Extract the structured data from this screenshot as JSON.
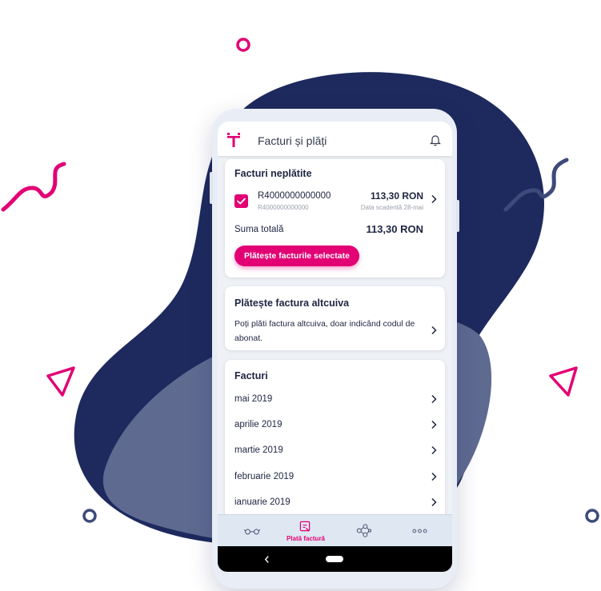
{
  "colors": {
    "brand": "#e20074",
    "navy": "#1e2a5e",
    "text": "#1e2541",
    "muted": "#9aa0ad"
  },
  "header": {
    "title": "Facturi și plăți",
    "logo_icon": "telekom-t-logo",
    "bell_icon": "bell-icon"
  },
  "unpaid": {
    "title": "Facturi neplătite",
    "invoice": {
      "checked": true,
      "id": "R4000000000000",
      "sub_id": "R4000000000000",
      "amount": "113,30 RON",
      "due": "Data scadentă 28-mai"
    },
    "total_label": "Suma totală",
    "total_value": "113,30 RON",
    "pay_button": "Plătește facturile selectate"
  },
  "pay_other": {
    "title": "Plătește factura altcuiva",
    "description": "Poți plăti factura altcuiva, doar indicând codul de abonat."
  },
  "invoices": {
    "title": "Facturi",
    "months": [
      "mai 2019",
      "aprilie 2019",
      "martie 2019",
      "februarie 2019",
      "ianuarie 2019"
    ]
  },
  "bottom_nav": {
    "items": [
      {
        "icon": "glasses-icon",
        "label": ""
      },
      {
        "icon": "invoice-payment-icon",
        "label": "Plată factură",
        "active": true
      },
      {
        "icon": "network-nodes-icon",
        "label": ""
      },
      {
        "icon": "more-dots-icon",
        "label": ""
      }
    ]
  },
  "system_nav": {
    "back_icon": "back-chevron-icon",
    "home_icon": "home-pill-icon"
  }
}
